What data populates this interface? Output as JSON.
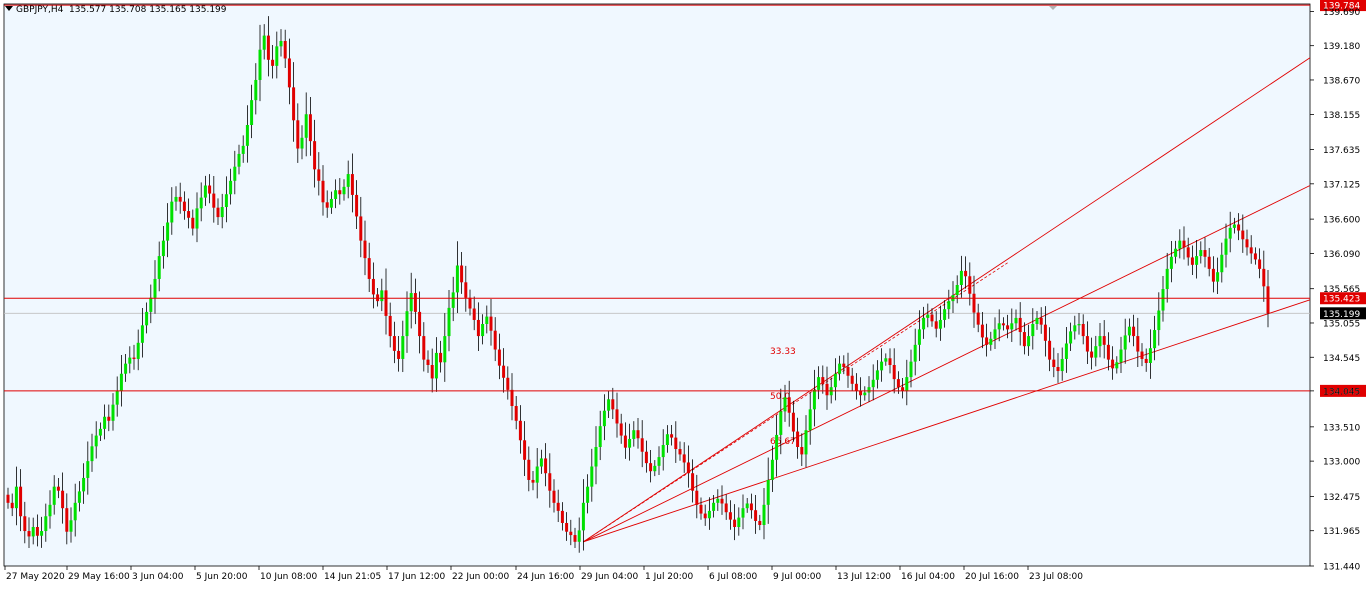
{
  "header": {
    "symbol": "GBPJPY,H4",
    "ohlc": "135.577 135.708 135.165 135.199"
  },
  "chart_data": {
    "type": "candlestick",
    "symbol": "GBPJPY",
    "timeframe": "H4",
    "colors": {
      "background": "#f0f8ff",
      "bull": "#00e000",
      "bear": "#e00000",
      "wick": "#000000",
      "lines": "#e00000",
      "grid_price": "#c0c0c0"
    },
    "y_axis": {
      "ticks": [
        "131.440",
        "131.965",
        "132.475",
        "133.000",
        "133.510",
        "134.045",
        "134.545",
        "135.055",
        "135.565",
        "136.090",
        "136.600",
        "137.125",
        "137.635",
        "138.155",
        "138.670",
        "139.180",
        "139.690"
      ],
      "ylim": [
        131.44,
        139.8
      ]
    },
    "x_axis": {
      "ticks": [
        "27 May 2020",
        "29 May 16:00",
        "3 Jun 04:00",
        "5 Jun 20:00",
        "10 Jun 08:00",
        "14 Jun 21:05",
        "17 Jun 12:00",
        "22 Jun 00:00",
        "24 Jun 16:00",
        "29 Jun 04:00",
        "1 Jul 20:00",
        "6 Jul 08:00",
        "9 Jul 00:00",
        "13 Jul 12:00",
        "16 Jul 04:00",
        "20 Jul 16:00",
        "23 Jul 08:00"
      ]
    },
    "horizontal_levels": [
      {
        "price": 139.784,
        "label": "139.784"
      },
      {
        "price": 135.423,
        "label": "135.423"
      },
      {
        "price": 134.045,
        "label": "134.045"
      }
    ],
    "current_price": {
      "price": 135.199,
      "label": "135.199"
    },
    "fan": {
      "origin": {
        "bar": 137,
        "price": 131.8
      },
      "anchor": {
        "bar": 238,
        "price": 135.95
      },
      "levels": [
        {
          "label": "33.33",
          "end_price": 139.0
        },
        {
          "label": "50.0",
          "end_price": 137.1
        },
        {
          "label": "66.67",
          "end_price": 135.4
        }
      ]
    },
    "prices": [
      132.38,
      132.3,
      132.62,
      132.18,
      131.96,
      131.88,
      132.02,
      131.89,
      131.96,
      132.18,
      132.35,
      132.62,
      132.56,
      132.3,
      131.95,
      132.12,
      132.38,
      132.55,
      132.75,
      133.0,
      133.22,
      133.38,
      133.48,
      133.66,
      133.6,
      133.84,
      134.05,
      134.3,
      134.45,
      134.54,
      134.52,
      134.76,
      135.02,
      135.22,
      135.43,
      135.71,
      136.05,
      136.28,
      136.55,
      136.86,
      136.93,
      136.86,
      136.72,
      136.62,
      136.46,
      136.76,
      136.92,
      137.1,
      136.98,
      136.77,
      136.63,
      136.78,
      136.97,
      137.17,
      137.38,
      137.57,
      137.69,
      138.0,
      138.37,
      138.67,
      139.12,
      139.33,
      138.97,
      138.88,
      139.17,
      139.25,
      138.99,
      138.56,
      138.07,
      137.65,
      137.81,
      138.16,
      137.76,
      137.34,
      137.17,
      136.85,
      136.77,
      136.9,
      137.03,
      136.97,
      137.08,
      137.27,
      136.96,
      136.64,
      136.28,
      136.02,
      135.71,
      135.48,
      135.38,
      135.54,
      135.16,
      134.86,
      134.64,
      134.52,
      134.86,
      135.23,
      135.5,
      135.22,
      134.86,
      134.51,
      134.43,
      134.23,
      134.61,
      134.47,
      134.86,
      135.28,
      135.51,
      135.91,
      135.66,
      135.43,
      135.27,
      135.1,
      134.86,
      135.04,
      135.15,
      134.94,
      134.66,
      134.42,
      134.24,
      134.06,
      133.82,
      133.6,
      133.31,
      133.02,
      132.72,
      132.68,
      132.92,
      133.04,
      132.82,
      132.56,
      132.38,
      132.26,
      132.08,
      131.95,
      131.9,
      131.8,
      131.97,
      132.38,
      132.62,
      132.92,
      133.21,
      133.52,
      133.75,
      133.92,
      133.77,
      133.56,
      133.38,
      133.2,
      133.33,
      133.46,
      133.34,
      133.14,
      132.97,
      132.85,
      132.93,
      133.06,
      133.24,
      133.4,
      133.35,
      133.18,
      133.1,
      132.98,
      132.82,
      132.56,
      132.35,
      132.22,
      132.15,
      132.26,
      132.38,
      132.44,
      132.37,
      132.24,
      132.13,
      132.02,
      132.16,
      132.3,
      132.37,
      132.27,
      132.11,
      132.05,
      132.35,
      132.72,
      133.02,
      133.39,
      133.74,
      133.95,
      133.72,
      133.44,
      133.21,
      133.1,
      133.46,
      133.77,
      134.06,
      134.25,
      134.15,
      133.98,
      134.1,
      134.3,
      134.45,
      134.4,
      134.27,
      134.15,
      134.05,
      133.98,
      134.02,
      134.1,
      134.21,
      134.35,
      134.48,
      134.53,
      134.43,
      134.22,
      134.1,
      134.05,
      134.25,
      134.48,
      134.73,
      134.96,
      135.13,
      135.18,
      135.08,
      134.97,
      135.1,
      135.26,
      135.38,
      135.47,
      135.62,
      135.83,
      135.75,
      135.49,
      135.21,
      135.03,
      134.84,
      134.73,
      134.82,
      134.96,
      135.05,
      135.02,
      134.96,
      135.05,
      135.13,
      134.92,
      134.71,
      134.86,
      135.04,
      135.13,
      135.03,
      134.79,
      134.51,
      134.4,
      134.34,
      134.52,
      134.75,
      134.93,
      135.02,
      135.04,
      134.86,
      134.63,
      134.54,
      134.71,
      134.86,
      134.73,
      134.51,
      134.38,
      134.47,
      134.66,
      134.87,
      135.0,
      134.86,
      134.63,
      134.52,
      134.46,
      134.68,
      134.95,
      135.24,
      135.56,
      135.86,
      136.04,
      136.16,
      136.28,
      136.18,
      136.03,
      135.92,
      136.05,
      136.14,
      136.04,
      135.86,
      135.67,
      135.81,
      136.07,
      136.31,
      136.47,
      136.52,
      136.43,
      136.3,
      136.18,
      136.09,
      136.0,
      135.86,
      135.6,
      135.199
    ]
  }
}
